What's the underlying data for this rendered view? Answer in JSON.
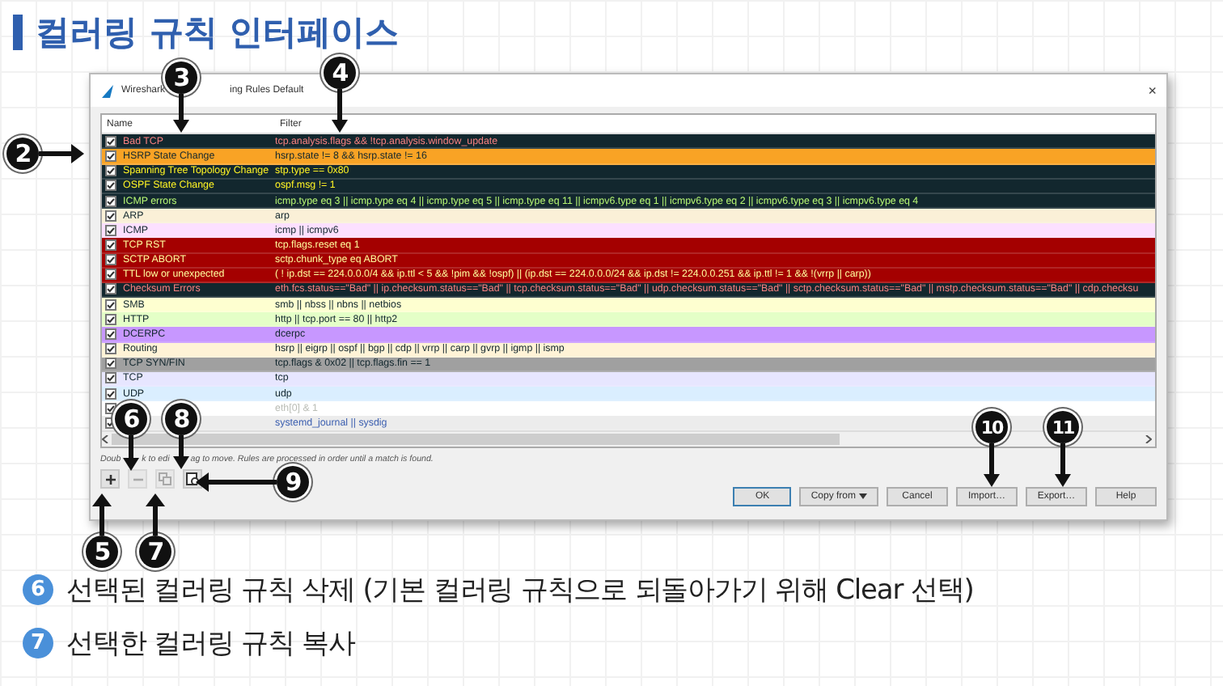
{
  "slide_title": "컬러링 규칙 인터페이스",
  "dialog": {
    "title_parts": [
      "Wireshark",
      "ing Rules Default"
    ],
    "close": "×",
    "columns": [
      "Name",
      "Filter"
    ],
    "rules": [
      {
        "name": "Bad TCP",
        "filter": "tcp.analysis.flags && !tcp.analysis.window_update",
        "checked": true,
        "color": "#12272e",
        "kind": "error"
      },
      {
        "name": "HSRP State Change",
        "filter": "hsrp.state != 8 && hsrp.state != 16",
        "checked": true,
        "color": "#f9a325",
        "kind": "normal"
      },
      {
        "name": "Spanning Tree Topology  Change",
        "filter": "stp.type == 0x80",
        "checked": true,
        "color": "#12272e",
        "kind": "change"
      },
      {
        "name": "OSPF State Change",
        "filter": "ospf.msg != 1",
        "checked": true,
        "color": "#12272e",
        "kind": "change"
      },
      {
        "name": "ICMP errors",
        "filter": "icmp.type eq 3 || icmp.type eq 4 || icmp.type eq 5 || icmp.type eq 11 || icmpv6.type eq 1 || icmpv6.type eq 2 || icmpv6.type eq 3 || icmpv6.type eq 4",
        "checked": true,
        "color": "#12272e",
        "kind": "icmp_error"
      },
      {
        "name": "ARP",
        "filter": "arp",
        "checked": true,
        "color": "#faf0d7",
        "kind": "normal"
      },
      {
        "name": "ICMP",
        "filter": "icmp || icmpv6",
        "checked": true,
        "color": "#fce0ff",
        "kind": "normal"
      },
      {
        "name": "TCP RST",
        "filter": "tcp.flags.reset eq 1",
        "checked": true,
        "color": "#a40000",
        "kind": "alert"
      },
      {
        "name": "SCTP ABORT",
        "filter": "sctp.chunk_type eq ABORT",
        "checked": true,
        "color": "#a40000",
        "kind": "alert"
      },
      {
        "name": "TTL low or unexpected",
        "filter": "( ! ip.dst == 224.0.0.0/4 && ip.ttl < 5 && !pim && !ospf) || (ip.dst == 224.0.0.0/24 && ip.dst != 224.0.0.251 && ip.ttl != 1 && !(vrrp || carp))",
        "checked": true,
        "color": "#a40000",
        "kind": "alert"
      },
      {
        "name": "Checksum Errors",
        "filter": "eth.fcs.status==\"Bad\" || ip.checksum.status==\"Bad\" || tcp.checksum.status==\"Bad\" || udp.checksum.status==\"Bad\" || sctp.checksum.status==\"Bad\" || mstp.checksum.status==\"Bad\" || cdp.checksu",
        "checked": true,
        "color": "#12272e",
        "kind": "error"
      },
      {
        "name": "SMB",
        "filter": "smb || nbss || nbns || netbios",
        "checked": true,
        "color": "#feffd0",
        "kind": "normal"
      },
      {
        "name": "HTTP",
        "filter": "http || tcp.port == 80 || http2",
        "checked": true,
        "color": "#e4ffc7",
        "kind": "normal"
      },
      {
        "name": "DCERPC",
        "filter": "dcerpc",
        "checked": true,
        "color": "#c797ff",
        "kind": "normal"
      },
      {
        "name": "Routing",
        "filter": "hsrp || eigrp || ospf || bgp || cdp || vrrp || carp || gvrp || igmp || ismp",
        "checked": true,
        "color": "#fff3d6",
        "kind": "normal"
      },
      {
        "name": "TCP SYN/FIN",
        "filter": "tcp.flags & 0x02 || tcp.flags.fin == 1",
        "checked": true,
        "color": "#a0a0a0",
        "kind": "normal"
      },
      {
        "name": "TCP",
        "filter": "tcp",
        "checked": true,
        "color": "#e7e6ff",
        "kind": "normal"
      },
      {
        "name": "UDP",
        "filter": "udp",
        "checked": true,
        "color": "#daeeff",
        "kind": "normal"
      },
      {
        "filter": "eth[0] & 1",
        "checked": true,
        "color": "#ffffff",
        "kind": "faint"
      },
      {
        "filter": "systemd_journal || sysdig",
        "checked": true,
        "color": "#ececec",
        "kind": "system"
      }
    ],
    "hint": [
      "Doub",
      "k to edi",
      "ag to move. Rules are processed in order until a match is found."
    ],
    "tools": [
      {
        "kind": "add",
        "disabled": false
      },
      {
        "kind": "remove",
        "disabled": true
      },
      {
        "kind": "copy",
        "disabled": true
      },
      {
        "kind": "clear",
        "disabled": false
      }
    ],
    "buttons": [
      {
        "label": "OK",
        "kind": "default"
      },
      {
        "label": "Copy from",
        "kind": "menu"
      },
      {
        "label": "Cancel",
        "kind": "plain"
      },
      {
        "label": "Import…",
        "kind": "plain"
      },
      {
        "label": "Export…",
        "kind": "plain"
      },
      {
        "label": "Help",
        "kind": "plain"
      }
    ]
  },
  "callouts": [
    {
      "number": "3",
      "kind": "down"
    },
    {
      "number": "4",
      "kind": "down"
    },
    {
      "number": "2",
      "kind": "right"
    },
    {
      "number": "6",
      "kind": "down"
    },
    {
      "number": "8",
      "kind": "down"
    },
    {
      "number": "9",
      "kind": "left"
    },
    {
      "number": "10",
      "kind": "down"
    },
    {
      "number": "11",
      "kind": "down"
    },
    {
      "number": "5",
      "kind": "up"
    },
    {
      "number": "7",
      "kind": "up"
    }
  ],
  "notes": [
    {
      "number": "6",
      "text": "선택된 컬러링 규칙 삭제 (기본 컬러링 규칙으로 되돌아가기 위해 Clear 선택)"
    },
    {
      "number": "7",
      "text": "선택한 컬러링 규칙 복사"
    }
  ]
}
